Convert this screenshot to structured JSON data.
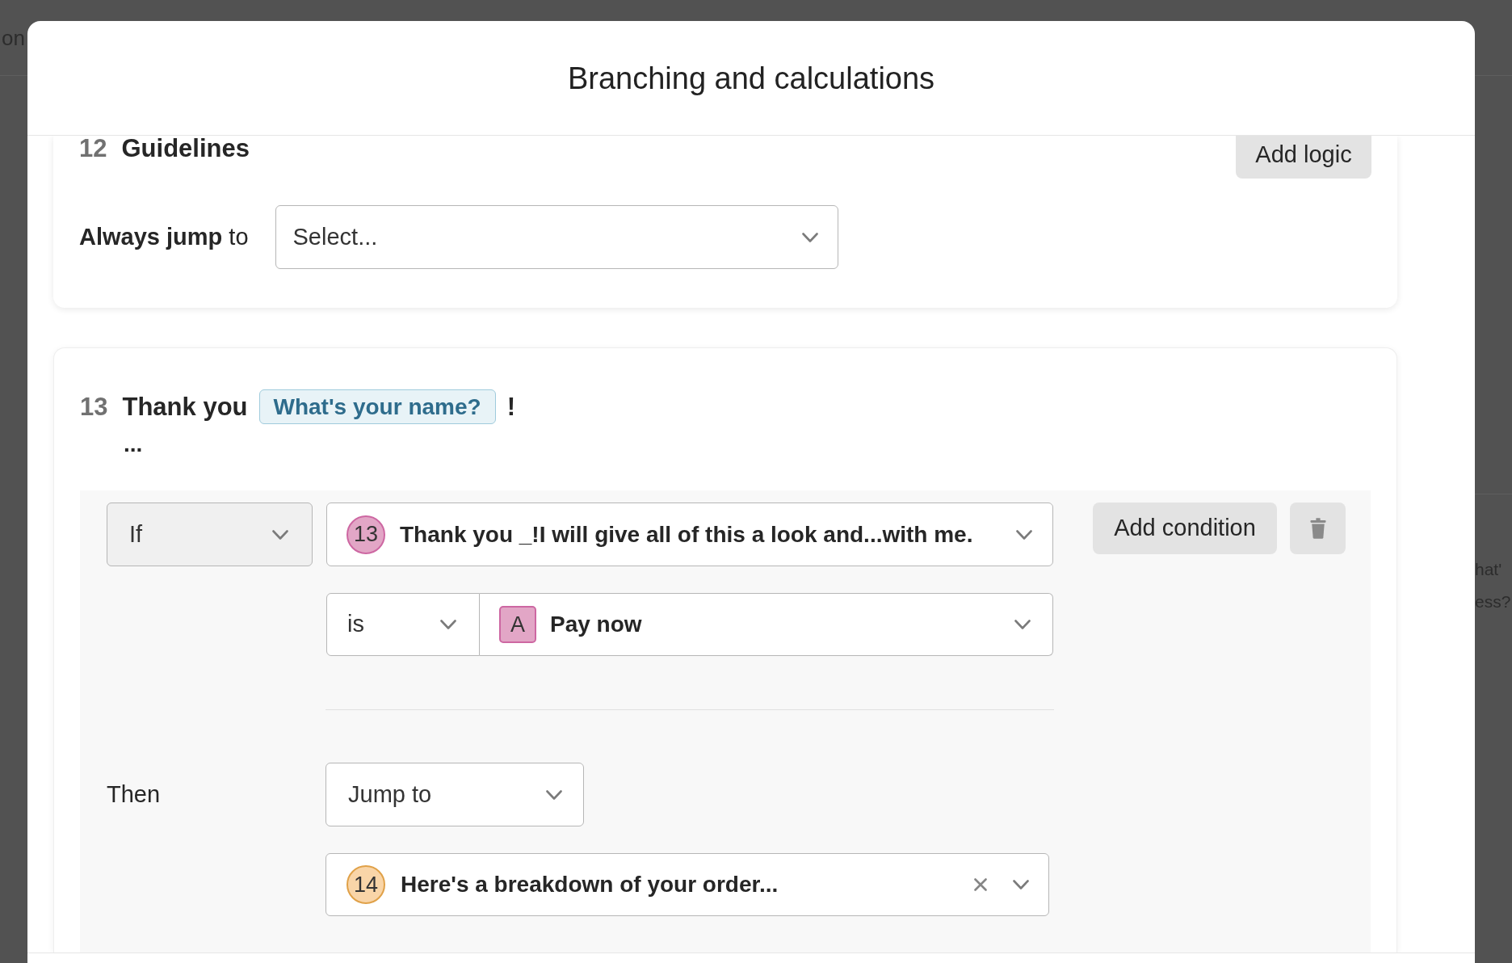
{
  "background": {
    "left_texts": [
      "on"
    ],
    "right_texts": [
      "hat'",
      "ess?"
    ]
  },
  "dialog": {
    "title": "Branching and calculations"
  },
  "blocks": [
    {
      "number": "12",
      "title_parts": [
        {
          "kind": "text",
          "text": "Guidelines"
        }
      ],
      "add_logic_button": "Add logic",
      "always_jump": {
        "label": "**Always jump** to",
        "placeholder": "Select..."
      }
    },
    {
      "number": "13",
      "title_parts": [
        {
          "kind": "text",
          "text": "Thank you"
        },
        {
          "kind": "tag",
          "text": "What's your name?"
        },
        {
          "kind": "text",
          "text": "!"
        }
      ],
      "continuation": "...",
      "rule": {
        "operator": "If",
        "question": {
          "badge": {
            "kind": "circle",
            "text": "13",
            "color": "#e2a6c6"
          },
          "text": "Thank you _!I will give all of this a look and...with me."
        },
        "comparator": "is",
        "answer": {
          "badge": {
            "kind": "square",
            "text": "A",
            "color": "#e2a6c6"
          },
          "text": "Pay now"
        },
        "add_condition_button": "Add condition",
        "action_label": "Then",
        "action": "Jump to",
        "target": {
          "badge": {
            "kind": "circle",
            "text": "14",
            "color": "#f9d5a8"
          },
          "text": "Here's a breakdown of your order...",
          "clearable": true
        }
      }
    }
  ]
}
